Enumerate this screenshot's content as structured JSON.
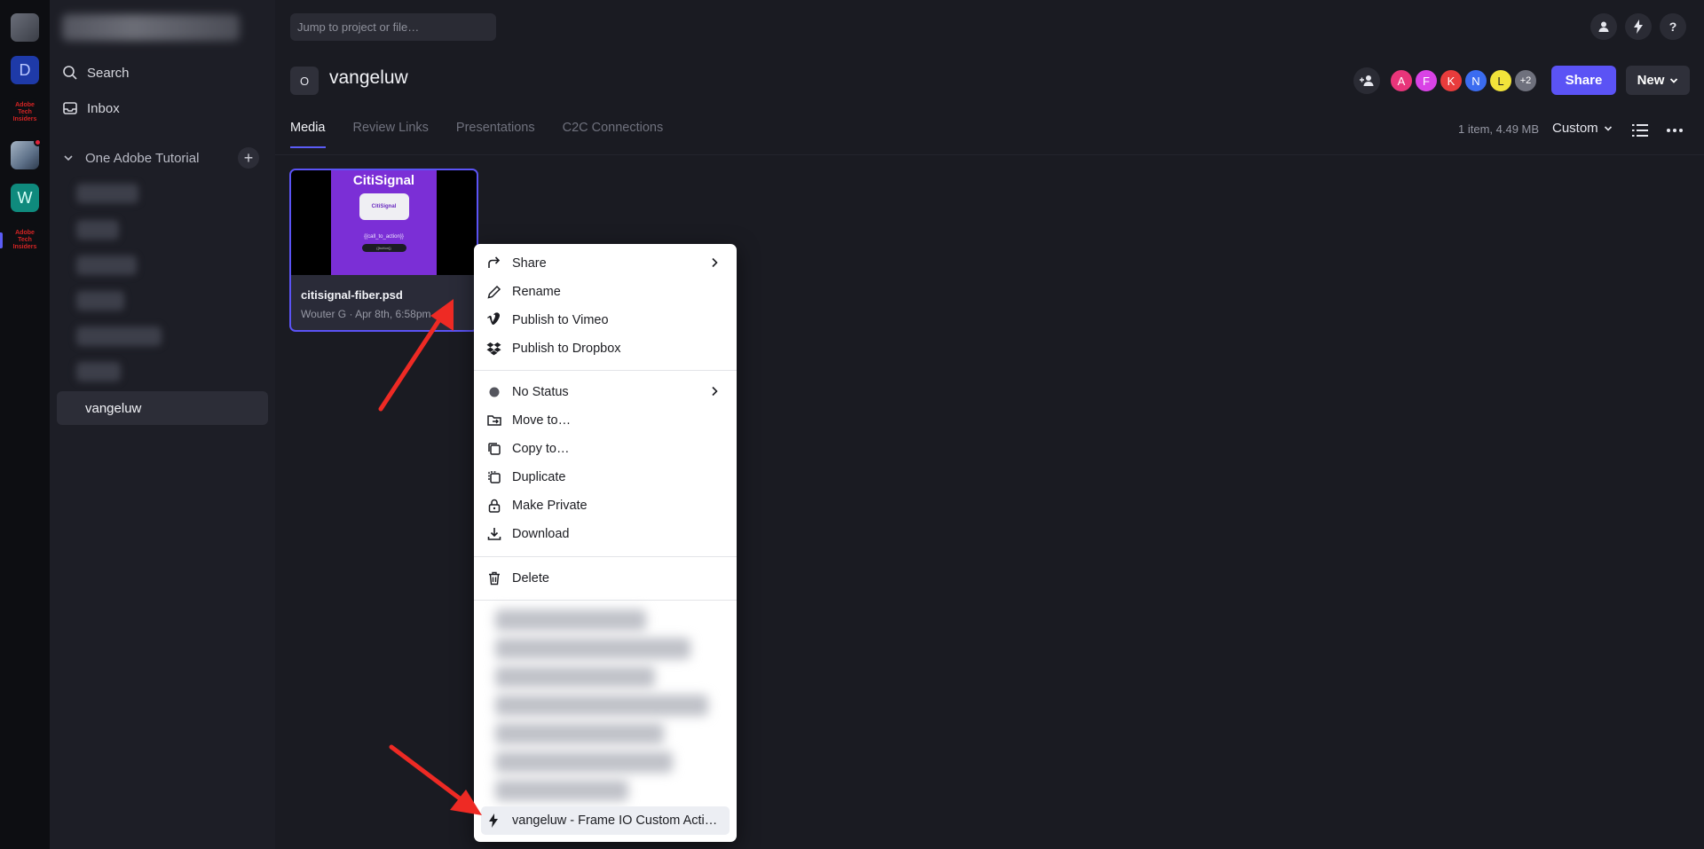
{
  "rail": {
    "workspace_d": "D",
    "workspace_w": "W",
    "adobe_label": "Adobe Tech Insiders"
  },
  "sidebar": {
    "search_label": "Search",
    "inbox_label": "Inbox",
    "project_group": "One Adobe Tutorial",
    "selected_item": "vangeluw"
  },
  "topbar": {
    "jump_placeholder": "Jump to project or file…",
    "help_label": "?"
  },
  "project": {
    "avatar_letter": "O",
    "title": "vangeluw",
    "members": [
      "A",
      "F",
      "K",
      "N",
      "L"
    ],
    "more_members": "+2",
    "member_colors": [
      "#e8357a",
      "#d943e6",
      "#e83c3c",
      "#3b6cf0",
      "#f2e33a"
    ],
    "share_label": "Share",
    "new_label": "New"
  },
  "tabs": [
    "Media",
    "Review Links",
    "Presentations",
    "C2C Connections"
  ],
  "toolbar": {
    "meta": "1 item, 4.49 MB",
    "sort_label": "Custom"
  },
  "asset": {
    "name": "citisignal-fiber.psd",
    "meta": "Wouter G · Apr 8th, 6:58pm",
    "thumb_brand": "CitiSignal",
    "thumb_router_label": "CitiSignal",
    "thumb_cta": "{{call_to_action}}",
    "thumb_button": "{{button}}"
  },
  "context_menu": {
    "group1": [
      {
        "label": "Share",
        "icon": "share-icon",
        "submenu": true
      },
      {
        "label": "Rename",
        "icon": "pencil-icon",
        "submenu": false
      },
      {
        "label": "Publish to Vimeo",
        "icon": "vimeo-icon",
        "submenu": false
      },
      {
        "label": "Publish to Dropbox",
        "icon": "dropbox-icon",
        "submenu": false
      }
    ],
    "group2": [
      {
        "label": "No Status",
        "icon": "status-dot-icon",
        "submenu": true
      },
      {
        "label": "Move to…",
        "icon": "move-icon",
        "submenu": false
      },
      {
        "label": "Copy to…",
        "icon": "copy-icon",
        "submenu": false
      },
      {
        "label": "Duplicate",
        "icon": "duplicate-icon",
        "submenu": false
      },
      {
        "label": "Make Private",
        "icon": "lock-icon",
        "submenu": false
      },
      {
        "label": "Download",
        "icon": "download-icon",
        "submenu": false
      }
    ],
    "delete_label": "Delete",
    "custom_action": "vangeluw - Frame IO Custom Acti…"
  },
  "colors": {
    "accent": "#5b53f5",
    "annotation": "#ee2a24"
  }
}
